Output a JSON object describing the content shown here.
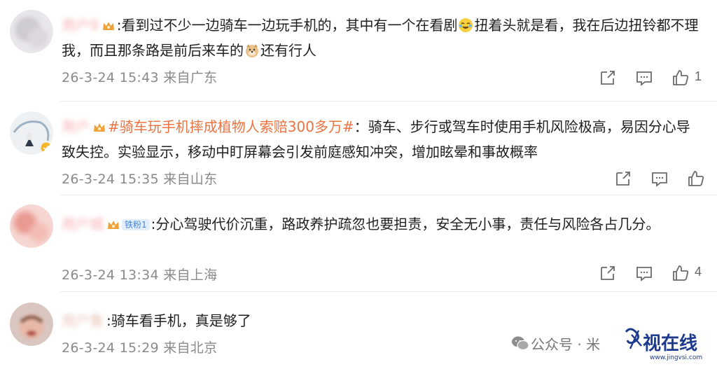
{
  "colors": {
    "text": "#1f1f1f",
    "meta": "#8a8a8a",
    "topic": "#eb7340",
    "username_blurred": "#f5a0a0",
    "icon": "#6b6b6b"
  },
  "comments": [
    {
      "username": "用户9",
      "text_part1": ":看到过不少一边骑车一边玩手机的，其中有一个在看剧",
      "text_part2": "扭着头就是看，我在后边扭铃都不理我，而且那条路是前后来车的",
      "text_part3": "还有行人",
      "emoji1": "laugh-cry-emoji",
      "emoji2": "doge-emoji",
      "timestamp": "26-3-24 15:43 来自广东",
      "like_count": "1"
    },
    {
      "username": "用户",
      "topic": "#骑车玩手机摔成植物人索赔300多万#",
      "text": "：骑车、步行或驾车时使用手机风险极高，易因分心导致失控。实验显示，移动中盯屏幕会引发前庭感知冲突，增加眩晕和事故概率",
      "timestamp": "26-3-24 15:35 来自山东",
      "like_count": ""
    },
    {
      "username": "用户城",
      "fan_badge": "铁粉1",
      "text": ":分心驾驶代价沉重，路政养护疏忽也要担责，安全无小事，责任与风险各占几分。",
      "timestamp": "26-3-24 13:34 来自上海",
      "like_count": "4"
    },
    {
      "username": "用户鲁",
      "text": ":骑车看手机，真是够了",
      "timestamp": "26-3-24 15:29 来自北京",
      "like_count": ""
    }
  ],
  "footer": {
    "wechat_label": "公众号 · 米",
    "brand_name": "视在线",
    "brand_url": "www.jingvsi.com"
  }
}
